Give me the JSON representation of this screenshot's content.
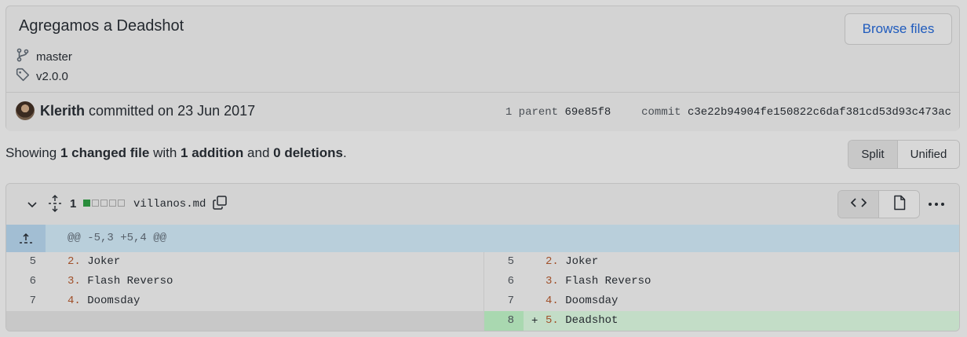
{
  "commit": {
    "title": "Agregamos a Deadshot",
    "browse_label": "Browse files",
    "branch": "master",
    "tag": "v2.0.0",
    "author": "Klerith",
    "committed_text": "committed on 23 Jun 2017",
    "parent_label": "1 parent",
    "parent_sha": "69e85f8",
    "commit_label": "commit",
    "commit_sha": "c3e22b94904fe150822c6daf381cd53d93c473ac"
  },
  "summary": {
    "prefix": "Showing",
    "changed": "1 changed file",
    "with": "with",
    "additions": "1 addition",
    "and": "and",
    "deletions": "0 deletions",
    "end": "."
  },
  "view_toggle": {
    "split": "Split",
    "unified": "Unified"
  },
  "file": {
    "change_count": "1",
    "diffstat": [
      "added",
      "neutral",
      "neutral",
      "neutral",
      "neutral"
    ],
    "name": "villanos.md",
    "hunk_header": "@@ -5,3 +5,4 @@",
    "left_lines": [
      {
        "num": "5",
        "marker": "2.",
        "text": " Joker"
      },
      {
        "num": "6",
        "marker": "3.",
        "text": " Flash Reverso"
      },
      {
        "num": "7",
        "marker": "4.",
        "text": " Doomsday"
      }
    ],
    "right_lines": [
      {
        "num": "5",
        "marker": "2.",
        "text": " Joker"
      },
      {
        "num": "6",
        "marker": "3.",
        "text": " Flash Reverso"
      },
      {
        "num": "7",
        "marker": "4.",
        "text": " Doomsday"
      },
      {
        "num": "8",
        "sign": "+",
        "marker": "5.",
        "text": " Deadshot"
      }
    ]
  },
  "colors": {
    "link": "#1f5bbd",
    "addition": "#2a8c3c",
    "hunk": "#b9cfdb"
  }
}
